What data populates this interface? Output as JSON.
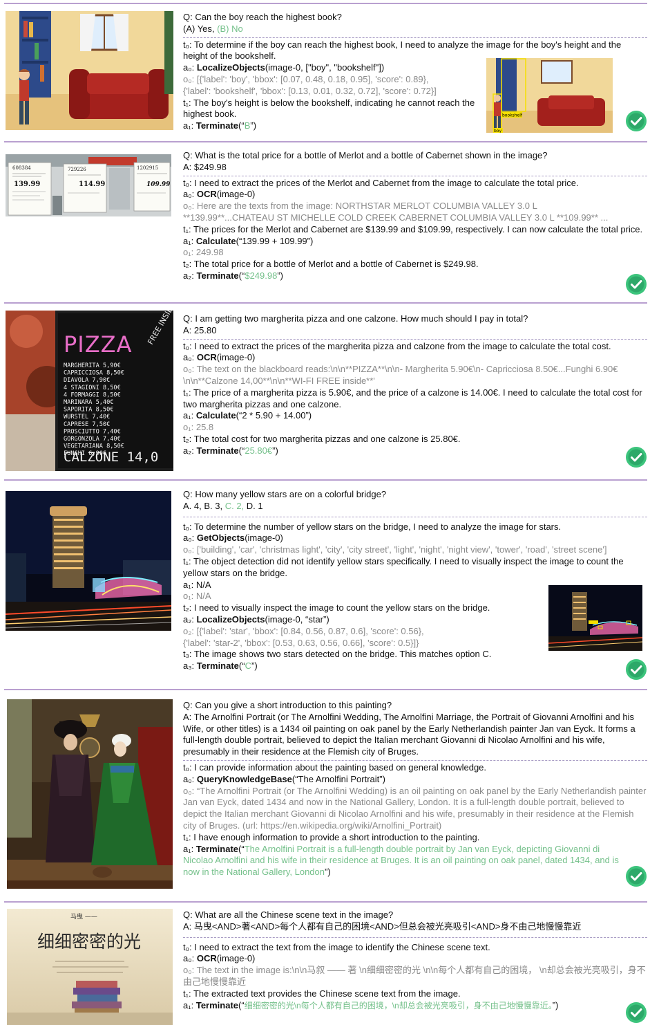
{
  "examples": [
    {
      "question": "Q: Can the boy reach the highest book?",
      "answer_prefix": "(A) Yes, ",
      "answer_highlight": "(B) No",
      "t0": "t₀: To determine if the boy can reach the highest book, I need to analyze the image for the boy's height and the height of the bookshelf.",
      "a0_prefix": "a₀: ",
      "a0_fn": "LocalizeObjects",
      "a0_args": "(image-0, [\"boy\", \"bookshelf\"])",
      "o0": "o₀: [{'label': 'boy', 'bbox': [0.07, 0.48, 0.18, 0.95], 'score': 0.89},",
      "o0b": "{'label': 'bookshelf', 'bbox': [0.13, 0.01, 0.32, 0.72], 'score': 0.72}]",
      "t1": "t₁: The boy's height is below the bookshelf, indicating he cannot reach the highest book.",
      "a1_prefix": "a₁: ",
      "a1_fn": "Terminate",
      "a1_open": "(“",
      "a1_ans": "B",
      "a1_close": "”)",
      "inset_label_1": "bookshelf",
      "inset_label_2": "boy"
    },
    {
      "question": "Q: What is the total price for a bottle of Merlot and a bottle of Cabernet shown in the image?",
      "answer": "A: $249.98",
      "t0": "t₀: I need to extract the prices of the Merlot and Cabernet from the image to calculate the total price.",
      "a0_prefix": "a₀: ",
      "a0_fn": "OCR",
      "a0_args": "(image-0)",
      "o0": "o₀: Here are the texts from the image: NORTHSTAR MERLOT  COLUMBIA VALLEY 3.0 L",
      "o0b": "**139.99**...CHATEAU ST MICHELLE COLD CREEK CABERNET COLUMBIA VALLEY 3.0 L **109.99** ...",
      "t1": "t₁: The prices for the Merlot and Cabernet are $139.99 and $109.99, respectively. I can now calculate the total price.",
      "a1_prefix": "a₁: ",
      "a1_fn": "Calculate",
      "a1_args": "(“139.99 + 109.99”)",
      "o1": "o₁: 249.98",
      "t2": "t₂: The total price for a bottle of Merlot and a bottle of Cabernet is $249.98.",
      "a2_prefix": "a₂: ",
      "a2_fn": "Terminate",
      "a2_open": "(“",
      "a2_ans": "$249.98",
      "a2_close": "”)",
      "tag_1": "608384",
      "tag_2": "729226",
      "tag_3": "1202915",
      "price_1": "139.99",
      "price_2": "114.99",
      "price_3": "109.99"
    },
    {
      "question": "Q: I am getting two margherita pizza and one calzone. How much should I pay in total?",
      "answer": "A: 25.80",
      "t0": "t₀: I need to extract the prices of the margherita pizza and calzone from the image to calculate the total cost.",
      "a0_prefix": "a₀: ",
      "a0_fn": "OCR",
      "a0_args": "(image-0)",
      "o0": "o₀: The text on the blackboard reads:\\n\\n**PIZZA**\\n\\n- Margherita 5.90€\\n- Capricciosa 8.50€...Funghi 6.90€\\n\\n**Calzone 14,00**\\n\\n**WI-FI FREE inside**'",
      "t1": "t₁: The price of a margherita pizza is 5.90€, and the price of a calzone is 14.00€. I need to calculate the total cost for two margherita pizzas and one calzone.",
      "a1_prefix": "a₁: ",
      "a1_fn": "Calculate",
      "a1_args": "(“2 * 5.90 + 14.00”)",
      "o1": "o₁: 25.8",
      "t2": "t₂: The total cost for two margherita pizzas and one calzone is 25.80€.",
      "a2_prefix": "a₂: ",
      "a2_fn": "Terminate",
      "a2_open": "(“",
      "a2_ans": "25.80€",
      "a2_close": "”)",
      "board_title": "PIZZA",
      "board_items": [
        "MARGHERITA  5,90€",
        "CAPRICCIOSA 8,50€",
        "DIAVOLA  7,90€",
        "4 STAGIONI 8,50€",
        "4 FORMAGGI 8,50€",
        "MARINARA  5,40€",
        "SAPORITA  8,50€",
        "WURSTEL  7,40€",
        "CAPRESE  7,50€",
        "PROSCIUTTO 7,40€",
        "GORGONZOLA 7,40€",
        "VEGETARIANA 8,50€",
        "FUNGHI  6,90€"
      ],
      "board_calzone": "CALZONE 14,0",
      "board_side": "FREE INSIDE"
    },
    {
      "question": "Q: How many yellow stars are on a colorful bridge?",
      "answer_prefix": "A. 4, B. 3, ",
      "answer_highlight": "C. 2,",
      "answer_suffix": " D. 1",
      "t0": "t₀: To determine the number of yellow stars on the bridge, I need to analyze the image for stars.",
      "a0_prefix": "a₀: ",
      "a0_fn": "GetObjects",
      "a0_args": "(image-0)",
      "o0": "o₀: ['building', 'car', 'christmas light', 'city', 'city street', 'light', 'night', 'night view', 'tower', 'road', 'street scene']",
      "t1": "t₁: The object detection did not identify yellow stars specifically. I need to visually inspect the image to count the yellow stars on the bridge.",
      "a1": "a₁: N/A",
      "o1": "o₁: N/A",
      "t2": "t₂: I need to visually inspect the image to count the yellow stars on the bridge.",
      "a2_prefix": "a₂: ",
      "a2_fn": "LocalizeObjects",
      "a2_args": "(image-0, “star”)",
      "o2": "o₂: [{'label': 'star', 'bbox': [0.84, 0.56, 0.87, 0.6], 'score': 0.56},",
      "o2b": "{'label': 'star-2', 'bbox': [0.53, 0.63, 0.56, 0.66], 'score': 0.5}]}",
      "t3": "t₃: The image shows two stars detected on the bridge. This matches option C.",
      "a3_prefix": "a₃: ",
      "a3_fn": "Terminate",
      "a3_open": "(“",
      "a3_ans": "C",
      "a3_close": "”)"
    },
    {
      "question": "Q: Can you give a short introduction to this painting?",
      "answer": "A: The Arnolfini Portrait (or The Arnolfini Wedding, The Arnolfini Marriage, the Portrait of Giovanni Arnolfini and his Wife, or other titles) is a 1434 oil painting on oak panel by the Early Netherlandish painter Jan van Eyck. It forms a full-length double portrait, believed to depict the Italian merchant Giovanni di Nicolao Arnolfini and his wife, presumably in their residence at the Flemish city of Bruges.",
      "t0": "t₀: I can provide information about the painting based on general knowledge.",
      "a0_prefix": "a₀: ",
      "a0_fn": "QueryKnowledgeBase",
      "a0_args": "(“The Arnolfini Portrait”)",
      "o0": "o₀: “The Arnolfini Portrait (or The Arnolfini Wedding) is an oil painting on oak panel by the Early Netherlandish painter Jan van Eyck, dated 1434 and now in the National Gallery, London. It is a full-length double portrait, believed to depict the Italian merchant Giovanni di Nicolao Arnolfini and his wife, presumably in their residence at the Flemish city of Bruges. (url: https://en.wikipedia.org/wiki/Arnolfini_Portrait)",
      "t1": "t₁: I have enough information to provide a short introduction to the painting.",
      "a1_prefix": "a₁: ",
      "a1_fn": "Terminate",
      "a1_open": "(“",
      "a1_ans": "The Arnolfini Portrait is a full-length double portrait by Jan van Eyck, depicting Giovanni di Nicolao Arnolfini and his wife in their residence at Bruges. It is an oil painting on oak panel, dated 1434, and is now in the National Gallery, London",
      "a1_close": "”)"
    },
    {
      "question": "Q: What are all the Chinese scene text in the image?",
      "answer": "A: 马曳<AND>著<AND>每个人都有自己的困境<AND>但总会被光亮吸引<AND>身不由己地慢慢靠近",
      "t0": "t₀: I need to extract the text from the image to identify the Chinese scene text.",
      "a0_prefix": "a₀: ",
      "a0_fn": "OCR",
      "a0_args": "(image-0)",
      "o0": "o₀: The text in the image is:\\n\\n马叙 —— 著  \\n细细密密的光  \\n\\n每个人都有自己的困境，  \\n却总会被光亮吸引，身不由己地慢慢靠近",
      "t1": "t₁: The extracted text provides the Chinese scene text from the image.",
      "a1_prefix": "a₁: ",
      "a1_fn": "Terminate",
      "a1_open": "(“",
      "a1_ans": "细细密密的光\\n每个人都有自己的困境，\\n却总会被光亮吸引，身不由己地慢慢靠近。",
      "a1_close": "”)",
      "book_title": "细细密密的光",
      "book_author": "马曳 ——"
    }
  ],
  "colors": {
    "separator": "#b9a0d0",
    "answer_green": "#74c08a",
    "observation_gray": "#8a8a8a",
    "check_green": "#3cc47c"
  }
}
